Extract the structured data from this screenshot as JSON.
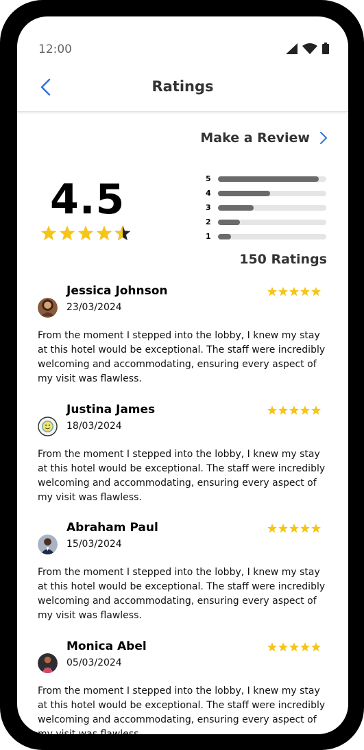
{
  "status": {
    "time": "12:00"
  },
  "header": {
    "title": "Ratings"
  },
  "make_review": {
    "label": "Make a Review"
  },
  "summary": {
    "average": "4.5",
    "average_value": 4.5,
    "total_label": "150 Ratings",
    "distribution": [
      {
        "star": "5",
        "fraction": 0.93
      },
      {
        "star": "4",
        "fraction": 0.48
      },
      {
        "star": "3",
        "fraction": 0.33
      },
      {
        "star": "2",
        "fraction": 0.2
      },
      {
        "star": "1",
        "fraction": 0.12
      }
    ]
  },
  "colors": {
    "star": "#F5C518",
    "accent": "#2F6FE0",
    "bar_fill": "#6B6B6B",
    "bar_track": "#E5E5E5"
  },
  "reviews": [
    {
      "name": "Jessica Johnson",
      "date": "23/03/2024",
      "stars": 5,
      "text": "From the moment I stepped into the lobby, I knew my stay at this hotel would be exceptional. The staff were incredibly welcoming and accommodating, ensuring every aspect of my visit was flawless."
    },
    {
      "name": "Justina James",
      "date": "18/03/2024",
      "stars": 5,
      "text": "From the moment I stepped into the lobby, I knew my stay at this hotel would be exceptional. The staff were incredibly welcoming and accommodating, ensuring every aspect of my visit was flawless."
    },
    {
      "name": "Abraham Paul",
      "date": "15/03/2024",
      "stars": 5,
      "text": "From the moment I stepped into the lobby, I knew my stay at this hotel would be exceptional. The staff were incredibly welcoming and accommodating, ensuring every aspect of my visit was flawless."
    },
    {
      "name": "Monica Abel",
      "date": "05/03/2024",
      "stars": 5,
      "text": "From the moment I stepped into the lobby, I knew my stay at this hotel would be exceptional. The staff were incredibly welcoming and accommodating, ensuring every aspect of my visit was flawless."
    }
  ]
}
